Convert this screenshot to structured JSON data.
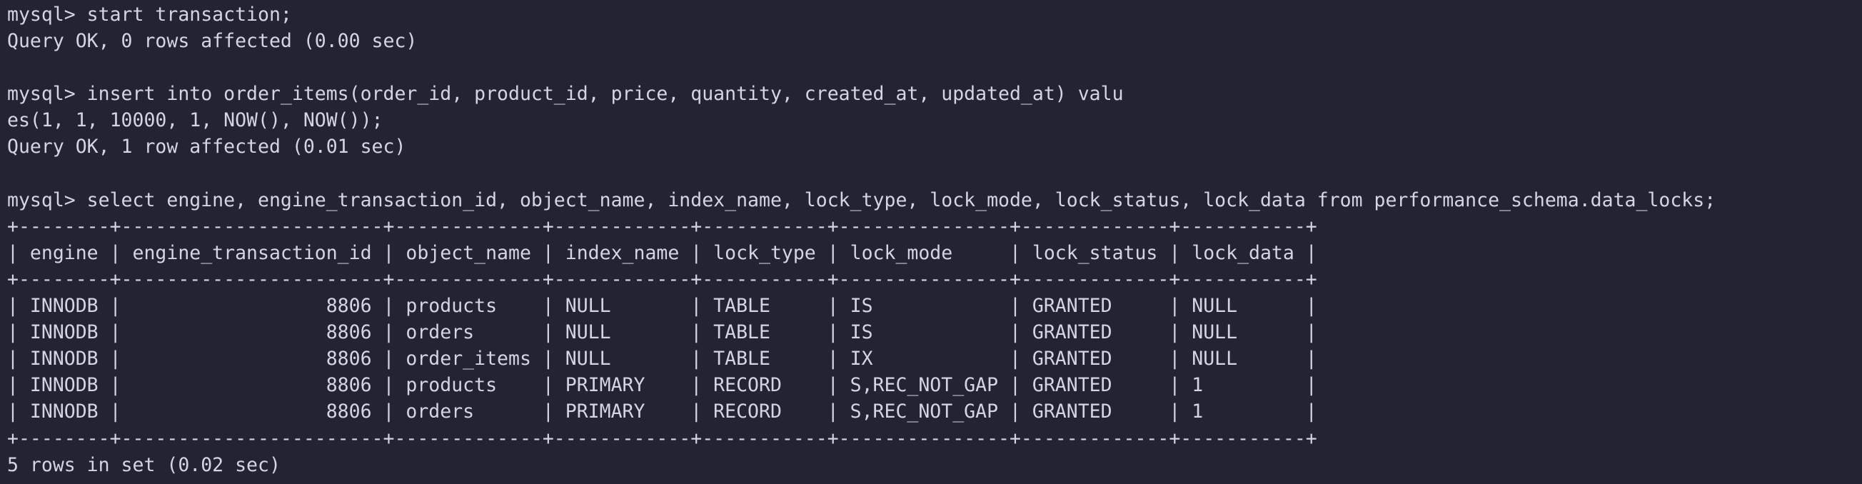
{
  "terminal": {
    "lines": [
      "mysql> start transaction;",
      "Query OK, 0 rows affected (0.00 sec)",
      "",
      "mysql> insert into order_items(order_id, product_id, price, quantity, created_at, updated_at) valu",
      "es(1, 1, 10000, 1, NOW(), NOW());",
      "Query OK, 1 row affected (0.01 sec)",
      "",
      "mysql> select engine, engine_transaction_id, object_name, index_name, lock_type, lock_mode, lock_status, lock_data from performance_schema.data_locks;",
      "+--------+-----------------------+-------------+------------+-----------+---------------+-------------+-----------+",
      "| engine | engine_transaction_id | object_name | index_name | lock_type | lock_mode     | lock_status | lock_data |",
      "+--------+-----------------------+-------------+------------+-----------+---------------+-------------+-----------+",
      "| INNODB |                  8806 | products    | NULL       | TABLE     | IS            | GRANTED     | NULL      |",
      "| INNODB |                  8806 | orders      | NULL       | TABLE     | IS            | GRANTED     | NULL      |",
      "| INNODB |                  8806 | order_items | NULL       | TABLE     | IX            | GRANTED     | NULL      |",
      "| INNODB |                  8806 | products    | PRIMARY    | RECORD    | S,REC_NOT_GAP | GRANTED     | 1         |",
      "| INNODB |                  8806 | orders      | PRIMARY    | RECORD    | S,REC_NOT_GAP | GRANTED     | 1         |",
      "+--------+-----------------------+-------------+------------+-----------+---------------+-------------+-----------+",
      "5 rows in set (0.02 sec)"
    ]
  }
}
